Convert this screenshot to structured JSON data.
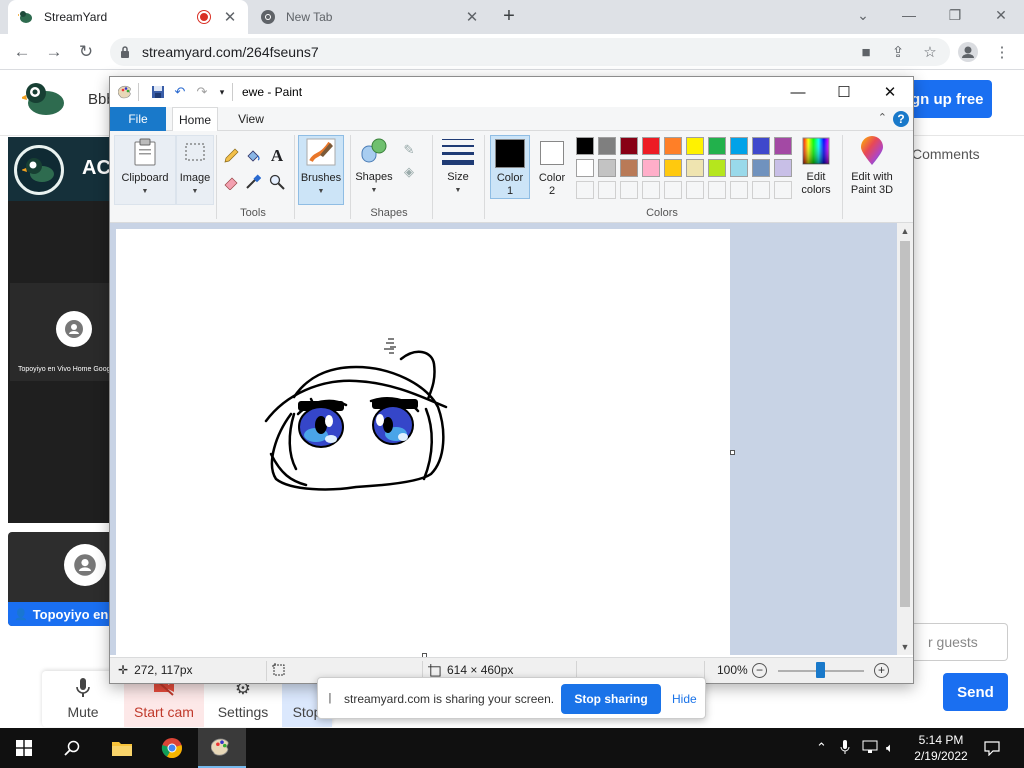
{
  "browser": {
    "tabs": [
      {
        "title": "StreamYard",
        "recording": true
      },
      {
        "title": "New Tab"
      }
    ],
    "url": "streamyard.com/264fseuns7"
  },
  "streamyard": {
    "brand_name_partial": "Bbb",
    "signup_label": "gn up free",
    "comments_label": "Comments",
    "banner_text": "AC",
    "camera_name": "Topoyiyo en Vivo Home Goog",
    "guest_name": "Topoyiyo en",
    "controls": {
      "mute": "Mute",
      "start_cam": "Start cam",
      "settings": "Settings",
      "stop": "Stop"
    },
    "guests_placeholder": "r guests",
    "send_label": "Send",
    "brand_color": "#1a6ff1"
  },
  "paint": {
    "title": "ewe - Paint",
    "tabs": {
      "file": "File",
      "home": "Home",
      "view": "View"
    },
    "groups": {
      "clipboard": "Clipboard",
      "image": "Image",
      "tools": "Tools",
      "brushes": "Brushes",
      "shapes_button": "Shapes",
      "shapes_group": "Shapes",
      "size": "Size",
      "colors": "Colors",
      "color1_a": "Color",
      "color1_b": "1",
      "color2_a": "Color",
      "color2_b": "2",
      "edit_colors_a": "Edit",
      "edit_colors_b": "colors",
      "edit3d_a": "Edit with",
      "edit3d_b": "Paint 3D"
    },
    "palette_row1": [
      "#000000",
      "#7f7f7f",
      "#880015",
      "#ed1c24",
      "#ff7f27",
      "#fff200",
      "#22b14c",
      "#00a2e8",
      "#3f48cc",
      "#a349a4"
    ],
    "palette_row2": [
      "#ffffff",
      "#c3c3c3",
      "#b97a57",
      "#ffaec9",
      "#ffc90e",
      "#efe4b0",
      "#b5e61d",
      "#99d9ea",
      "#7092be",
      "#c8bfe7"
    ],
    "color1": "#000000",
    "color2": "#ffffff",
    "status": {
      "cursor": "272, 117px",
      "canvas_size": "614 × 460px",
      "zoom": "100%"
    }
  },
  "share_notice": {
    "message": "streamyard.com is sharing your screen.",
    "stop_label": "Stop sharing",
    "hide_label": "Hide"
  },
  "taskbar": {
    "time": "5:14 PM",
    "date": "2/19/2022"
  }
}
